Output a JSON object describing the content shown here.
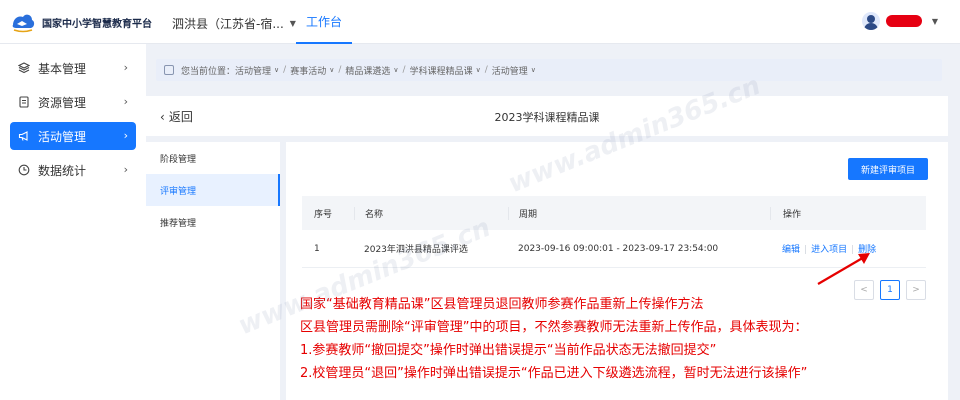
{
  "topbar": {
    "logo_text": "国家中小学智慧教育平台",
    "region": "泗洪县（江苏省-宿...",
    "workbench": "工作台"
  },
  "sidebar": {
    "items": [
      {
        "label": "基本管理",
        "icon": "cube-icon"
      },
      {
        "label": "资源管理",
        "icon": "document-icon"
      },
      {
        "label": "活动管理",
        "icon": "megaphone-icon",
        "active": true
      },
      {
        "label": "数据统计",
        "icon": "clock-icon"
      }
    ]
  },
  "breadcrumb": {
    "prefix": "您当前位置：",
    "items": [
      "活动管理",
      "赛事活动",
      "精品课遴选",
      "学科课程精品课",
      "活动管理"
    ]
  },
  "header": {
    "back_label": "返回",
    "title": "2023学科课程精品课"
  },
  "tabs": [
    "阶段管理",
    "评审管理",
    "推荐管理"
  ],
  "content": {
    "new_button": "新建评审项目",
    "table": {
      "headers": [
        "序号",
        "名称",
        "周期",
        "操作"
      ],
      "rows": [
        {
          "index": "1",
          "name": "2023年泗洪县精品课评选",
          "period": "2023-09-16 09:00:01 - 2023-09-17 23:54:00",
          "actions": [
            "编辑",
            "进入项目",
            "删除"
          ]
        }
      ]
    },
    "pagination": {
      "prev": "<",
      "page": "1",
      "next": ">"
    }
  },
  "annotation": {
    "lines": [
      "国家“基础教育精品课”区县管理员退回教师参赛作品重新上传操作方法",
      "区县管理员需删除“评审管理”中的项目，不然参赛教师无法重新上传作品，具体表现为：",
      "1.参赛教师“撤回提交”操作时弹出错误提示“当前作品状态无法撤回提交”",
      "2.校管理员“退回”操作时弹出错误提示“作品已进入下级遴选流程，暂时无法进行该操作”"
    ],
    "color": "#e60000"
  },
  "watermark": "www.admin365.cn",
  "colors": {
    "accent": "#1677ff"
  }
}
